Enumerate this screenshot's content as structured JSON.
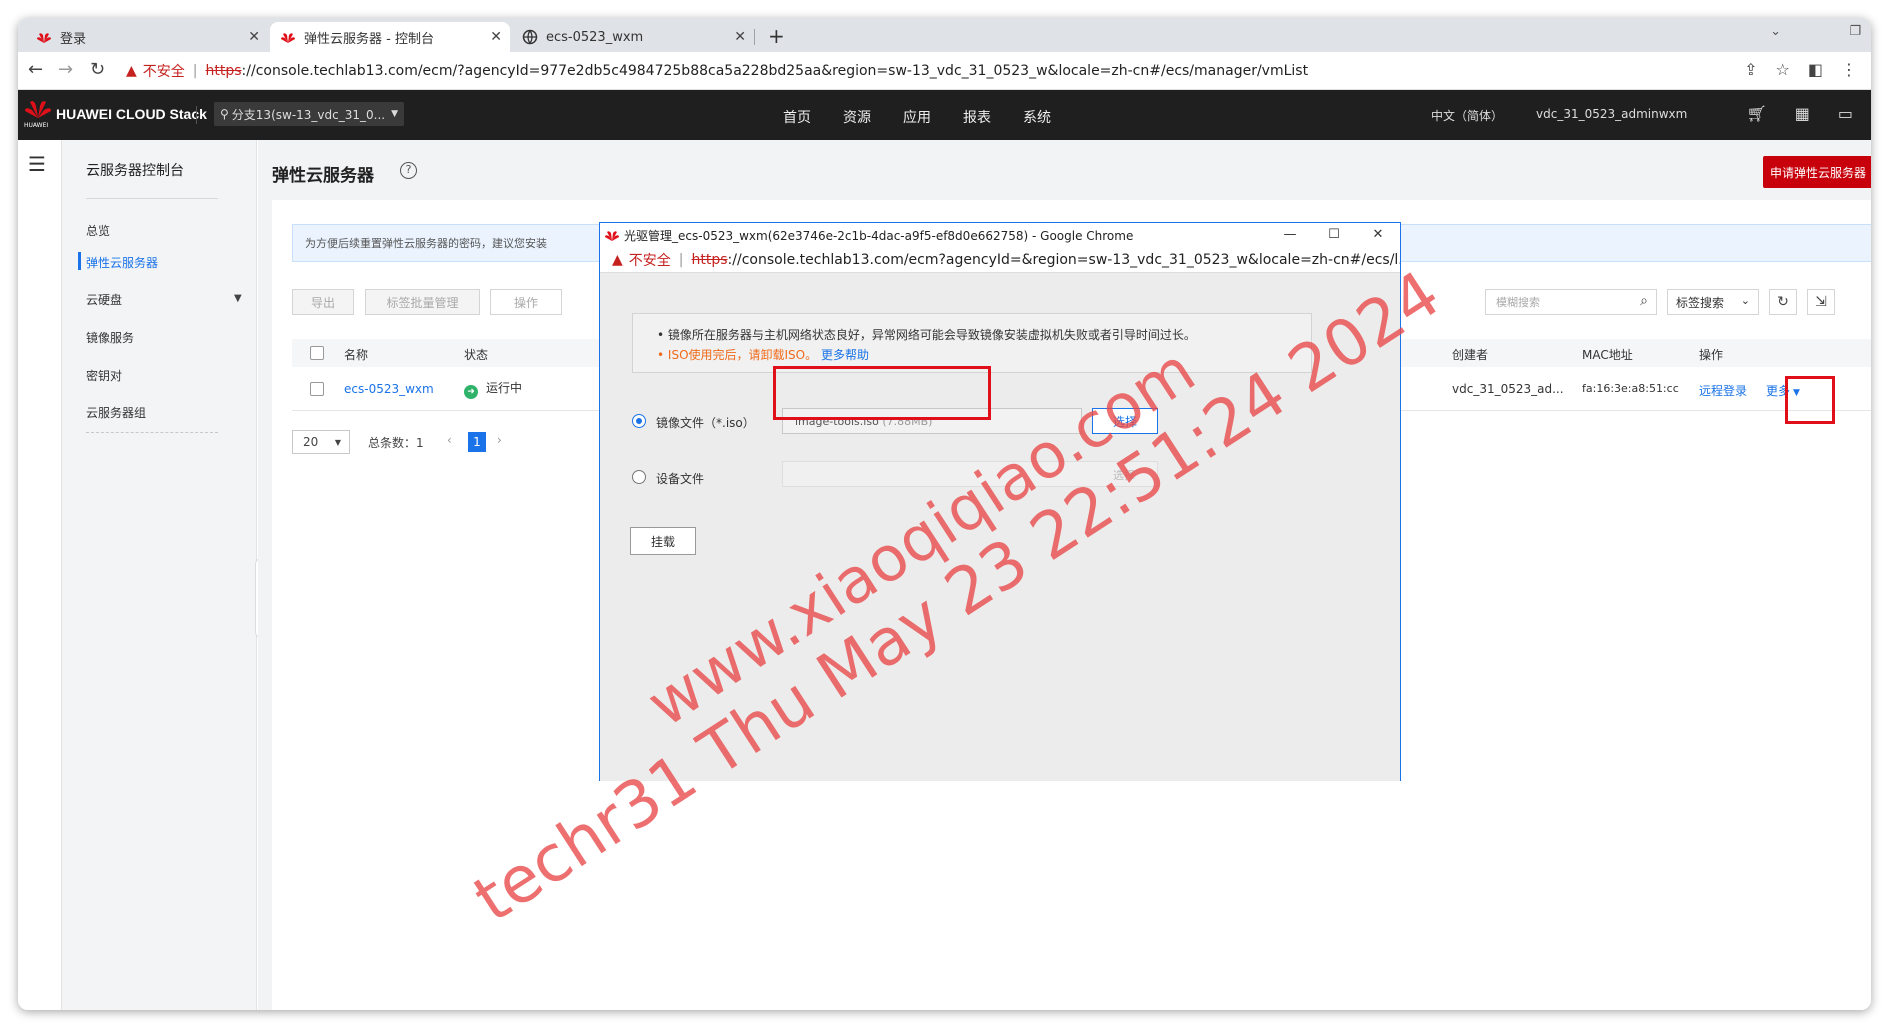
{
  "tabs": [
    {
      "title": "登录",
      "icon": "huawei-logo-icon"
    },
    {
      "title": "弹性云服务器 - 控制台",
      "icon": "huawei-logo-icon",
      "active": true
    },
    {
      "title": "ecs-0523_wxm",
      "icon": "globe-icon"
    }
  ],
  "address": {
    "insecure_label": "不安全",
    "scheme": "https",
    "rest": "://console.techlab13.com/ecm/?agencyId=977e2db5c4984725b88ca5a228bd25aa&region=sw-13_vdc_31_0523_w&locale=zh-cn#/ecs/manager/vmList"
  },
  "header": {
    "brand": "HUAWEI CLOUD Stack",
    "logo_text": "HUAWEI",
    "region": "分支13(sw-13_vdc_31_0...",
    "nav": [
      "首页",
      "资源",
      "应用",
      "报表",
      "系统"
    ],
    "lang": "中文（简体）",
    "user": "vdc_31_0523_adminwxm"
  },
  "sidebar": {
    "title": "云服务器控制台",
    "items": [
      "总览",
      "弹性云服务器",
      "云硬盘",
      "镜像服务",
      "密钥对",
      "云服务器组"
    ]
  },
  "main": {
    "title": "弹性云服务器",
    "apply_button": "申请弹性云服务器",
    "info": "为方便后续重置弹性云服务器的密码，建议您安装",
    "toolbar": {
      "export": "导出",
      "tag_batch": "标签批量管理",
      "ops": "操作"
    },
    "search_placeholder": "模糊搜索",
    "tag_search": "标签搜索",
    "columns": [
      "名称",
      "状态",
      "创建者",
      "MAC地址",
      "操作"
    ],
    "rows": [
      {
        "name": "ecs-0523_wxm",
        "status": "运行中",
        "creator": "vdc_31_0523_ad...",
        "mac": "fa:16:3e:a8:51:cc",
        "remote": "远程登录",
        "more": "更多"
      }
    ],
    "pager": {
      "page_size": "20",
      "total": "总条数：1",
      "current": "1"
    }
  },
  "popup": {
    "title": "光驱管理_ecs-0523_wxm(62e3746e-2c1b-4dac-a9f5-ef8d0e662758) - Google Chrome",
    "insecure_label": "不安全",
    "scheme": "https",
    "url_rest": "://console.techlab13.com/ecm?agencyId=&region=sw-13_vdc_31_0523_w&locale=zh-cn#/ecs/l...",
    "note1": "镜像所在服务器与主机网络状态良好，异常网络可能会导致镜像安装虚拟机失败或者引导时间过长。",
    "note2_prefix": "ISO使用完后，请卸载ISO。",
    "note2_link": "更多帮助",
    "option_image": "镜像文件（*.iso）",
    "option_device": "设备文件",
    "file_name": "image-tools.iso",
    "file_size": "(7.88MB)",
    "select_btn": "选择",
    "select_btn_disabled": "选择",
    "mount_btn": "挂载"
  },
  "watermark": {
    "line1": "www.xiaoqiqiao.com",
    "line2": "techr31 Thu May 23 22:51:24 2024"
  },
  "colors": {
    "accent": "#1a73e8",
    "brand_red": "#c7000b",
    "highlight": "#e0101a",
    "watermark": "#e84646"
  }
}
